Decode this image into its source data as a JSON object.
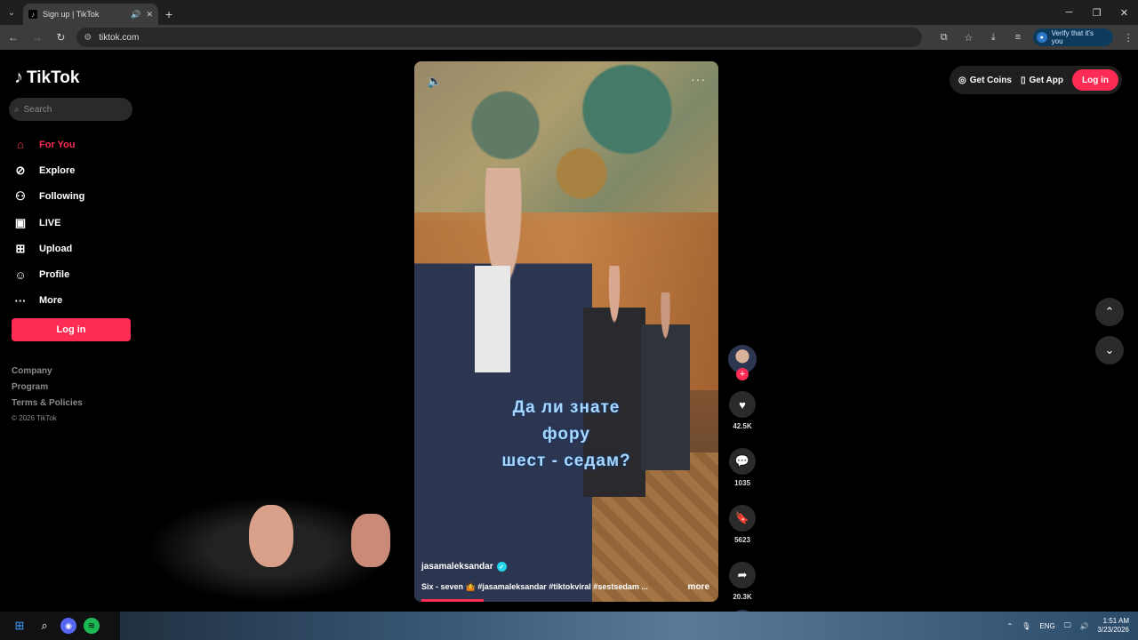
{
  "browser": {
    "tab_title": "Sign up | TikTok",
    "url": "tiktok.com",
    "verify_label": "Verify that it's you"
  },
  "sidebar": {
    "logo_text": "TikTok",
    "search_placeholder": "Search",
    "items": [
      {
        "label": "For You",
        "icon": "home-icon",
        "active": true
      },
      {
        "label": "Explore",
        "icon": "compass-icon"
      },
      {
        "label": "Following",
        "icon": "following-icon"
      },
      {
        "label": "LIVE",
        "icon": "live-icon"
      },
      {
        "label": "Upload",
        "icon": "upload-icon"
      },
      {
        "label": "Profile",
        "icon": "profile-icon"
      },
      {
        "label": "More",
        "icon": "more-icon"
      }
    ],
    "login_label": "Log in",
    "footer": [
      "Company",
      "Program",
      "Terms & Policies"
    ],
    "copyright": "© 2026 TikTok"
  },
  "video": {
    "caption_lines": [
      "Да ли знате",
      "фору",
      "шест - седам?"
    ],
    "username": "jasamaleksandar",
    "description": "Six - seven 🤷 #jasamaleksandar #tiktokviral #sestsedam ...",
    "more_label": "more"
  },
  "actions": {
    "likes": "42.5K",
    "comments": "1035",
    "saves": "5623",
    "shares": "20.3K"
  },
  "topbar": {
    "get_coins": "Get Coins",
    "get_app": "Get App",
    "login": "Log in"
  },
  "taskbar": {
    "lang": "ENG",
    "time": "1:51 AM",
    "date": "3/23/2026"
  },
  "colors": {
    "accent": "#fe2c55",
    "background": "#000000"
  }
}
